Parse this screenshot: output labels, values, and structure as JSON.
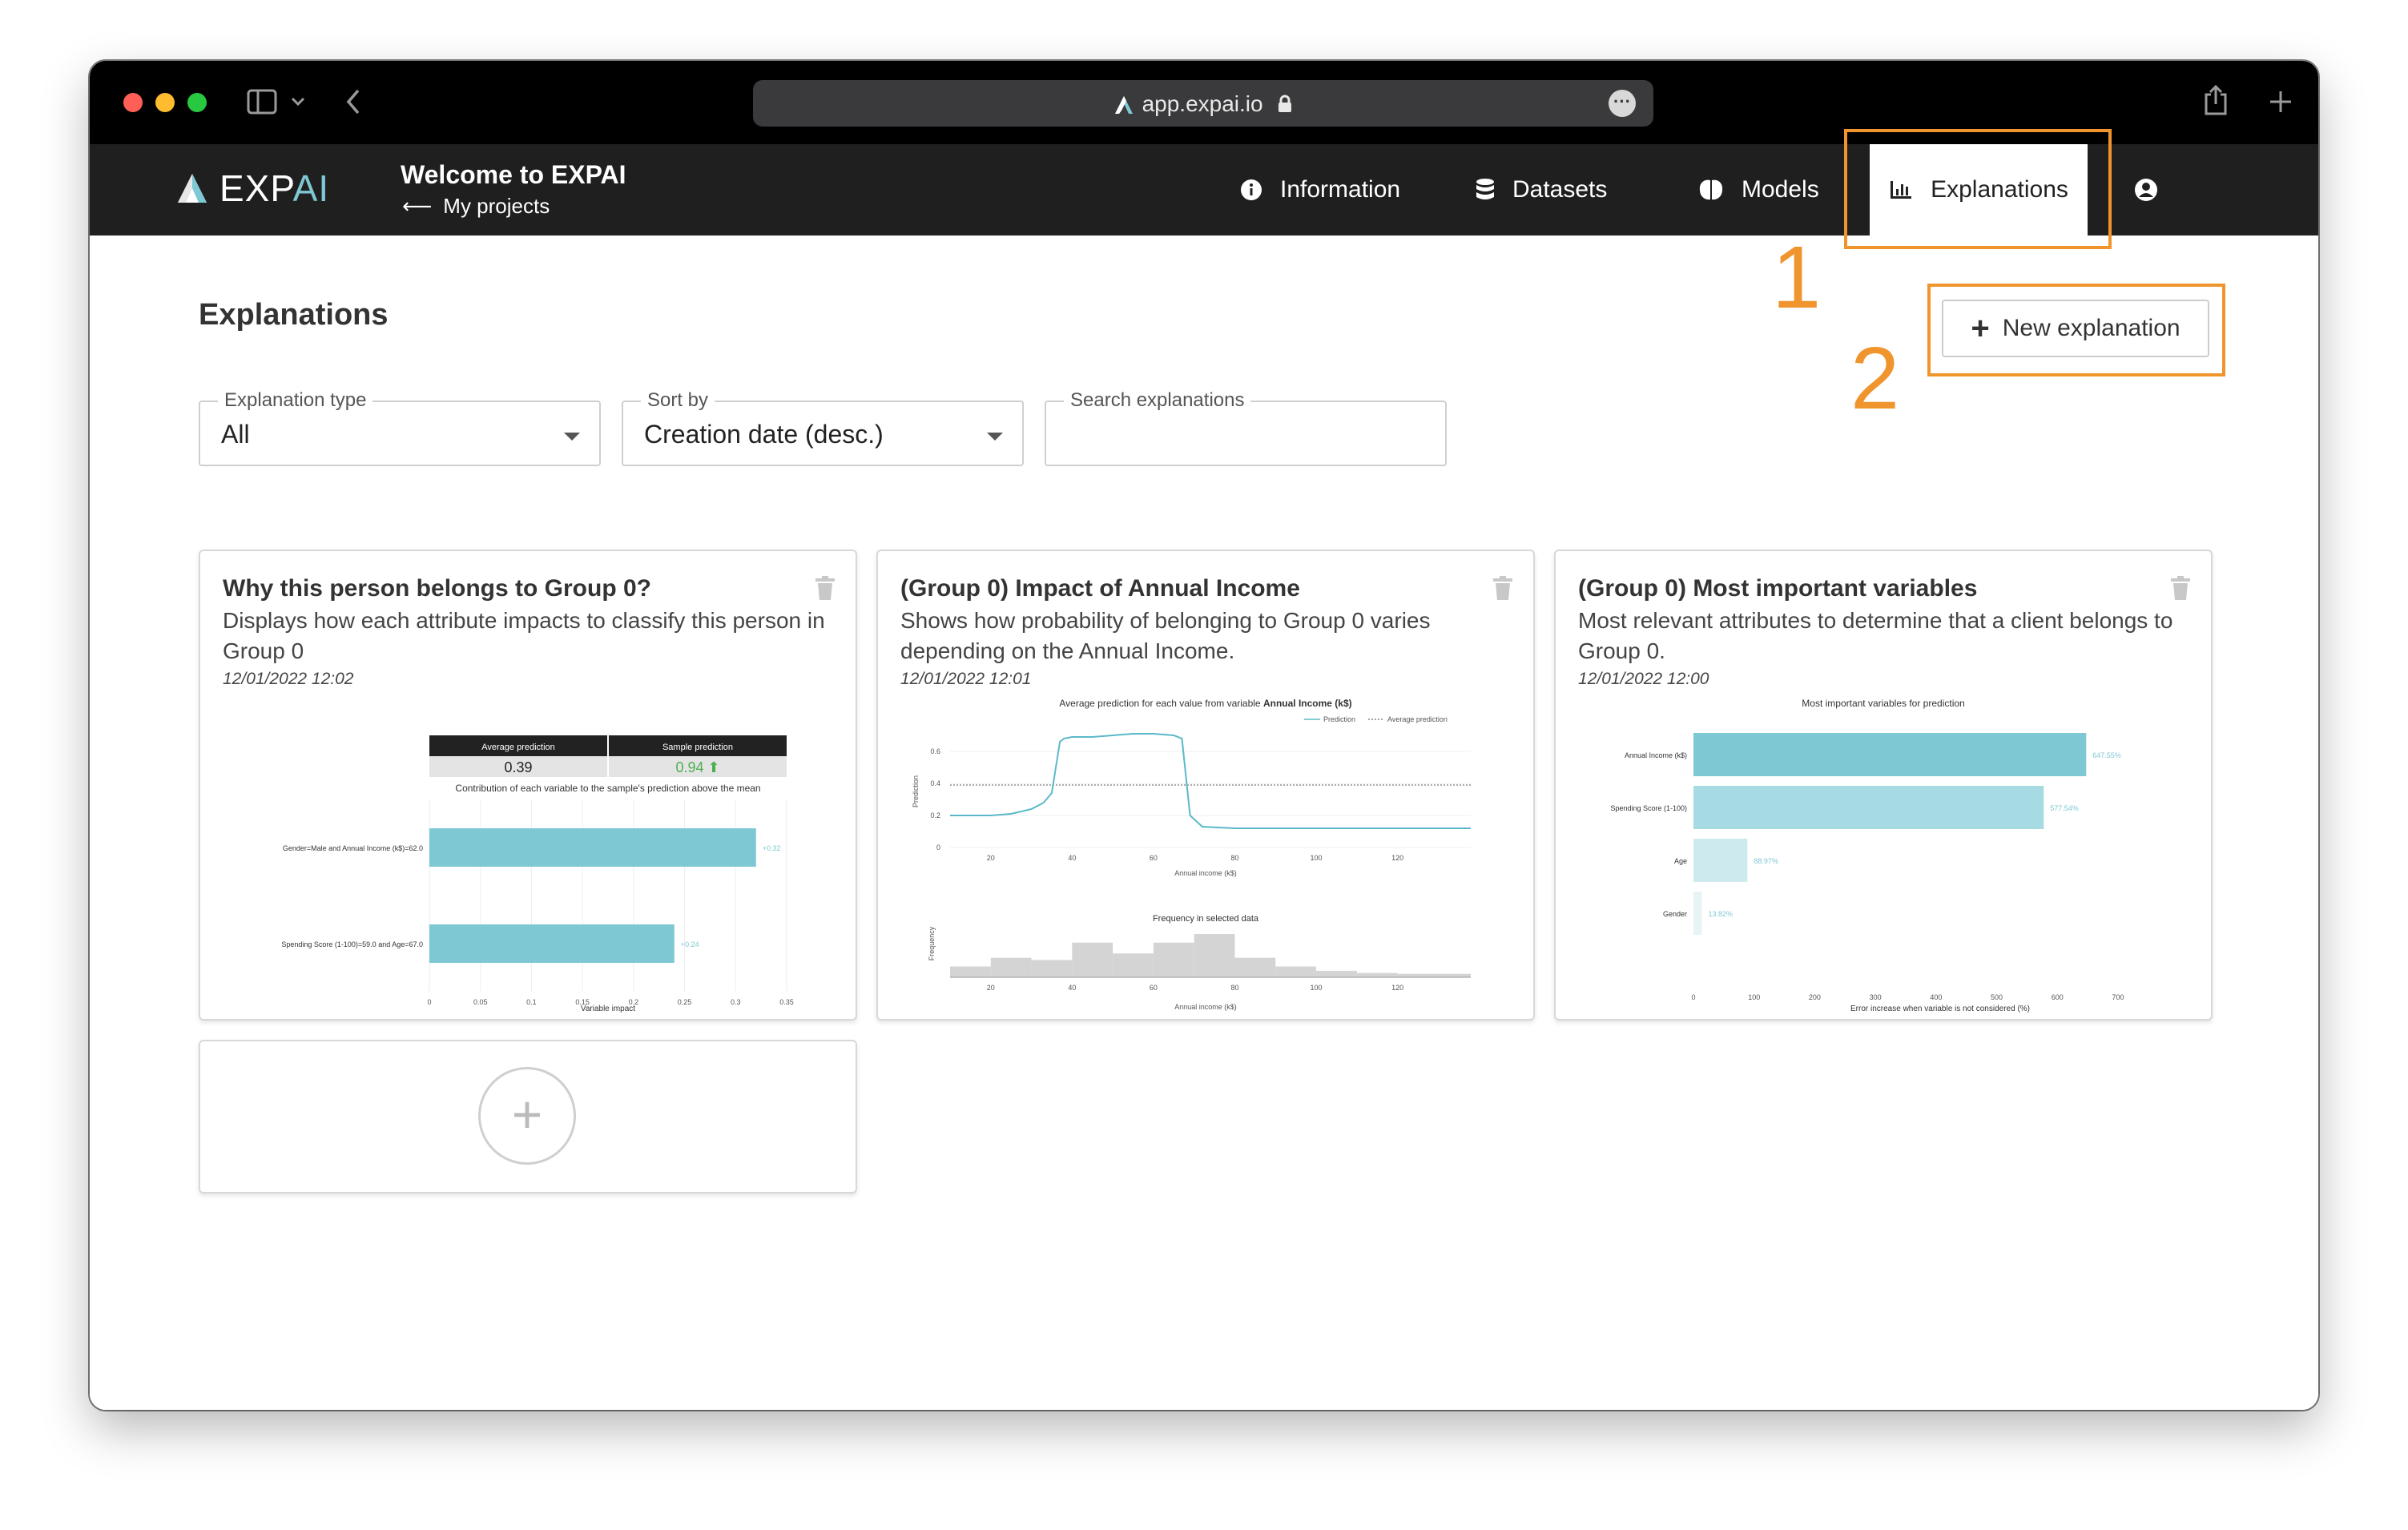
{
  "browser": {
    "url": "app.expai.io"
  },
  "header": {
    "logo_main": "EXP",
    "logo_accent": "AI",
    "project_title": "Welcome to EXPAI",
    "back_link": "My projects",
    "nav": [
      {
        "label": "Information",
        "icon": "info-icon"
      },
      {
        "label": "Datasets",
        "icon": "database-icon"
      },
      {
        "label": "Models",
        "icon": "brain-icon"
      },
      {
        "label": "Explanations",
        "icon": "bar-chart-icon"
      }
    ]
  },
  "main": {
    "title": "Explanations",
    "new_button": "New explanation",
    "filters": {
      "type_label": "Explanation type",
      "type_value": "All",
      "sort_label": "Sort by",
      "sort_value": "Creation date (desc.)",
      "search_label": "Search explanations"
    },
    "cards": [
      {
        "title": "Why this person belongs to Group 0?",
        "description": "Displays how each attribute impacts to classify this person in Group 0",
        "date": "12/01/2022 12:02"
      },
      {
        "title": "(Group 0) Impact of Annual Income",
        "description": "Shows how probability of belonging to Group 0 varies depending on the Annual Income.",
        "date": "12/01/2022 12:01"
      },
      {
        "title": "(Group 0) Most important variables",
        "description": "Most relevant attributes to determine that a client belongs to Group 0.",
        "date": "12/01/2022 12:00"
      }
    ]
  },
  "annotations": {
    "first": "1",
    "second": "2"
  },
  "colors": {
    "accent": "#7ec8d4",
    "highlight": "#f0952e",
    "navbar": "#1f1f1f"
  },
  "chart_data": [
    {
      "type": "bar",
      "orientation": "horizontal",
      "title": "Contribution of each variable to the sample's prediction above the mean",
      "xlabel": "Variable impact",
      "xlim": [
        0,
        0.35
      ],
      "x_ticks": [
        "0",
        "0.05",
        "0.1",
        "0.15",
        "0.2",
        "0.25",
        "0.3",
        "0.35"
      ],
      "summary": {
        "avg_label": "Average prediction",
        "avg_value": "0.39",
        "sample_label": "Sample prediction",
        "sample_value": "0.94 ⬆"
      },
      "categories": [
        "Gender=Male and Annual Income (k$)=62.0",
        "Spending Score (1-100)=59.0 and Age=67.0"
      ],
      "values": [
        0.32,
        0.24
      ],
      "value_labels": [
        "+0.32",
        "+0.24"
      ]
    },
    {
      "type": "line",
      "title_prefix": "Average prediction for each value from variable ",
      "title_bold": "Annual Income (k$)",
      "xlabel": "Annual income (k$)",
      "ylabel": "Prediction",
      "xlim": [
        10,
        138
      ],
      "ylim": [
        0,
        0.75
      ],
      "y_ticks": [
        "0",
        "0.2",
        "0.4",
        "0.6"
      ],
      "x_ticks": [
        "20",
        "40",
        "60",
        "80",
        "100",
        "120"
      ],
      "legend": [
        "Prediction",
        "Average prediction"
      ],
      "average": 0.39,
      "x": [
        10,
        20,
        25,
        30,
        33,
        35,
        37,
        38,
        40,
        45,
        50,
        55,
        60,
        65,
        67,
        69,
        72,
        80,
        100,
        120,
        138
      ],
      "y": [
        0.2,
        0.2,
        0.21,
        0.24,
        0.28,
        0.34,
        0.66,
        0.68,
        0.69,
        0.69,
        0.7,
        0.71,
        0.71,
        0.7,
        0.68,
        0.2,
        0.13,
        0.12,
        0.12,
        0.12,
        0.12
      ],
      "histogram": {
        "title": "Frequency in selected data",
        "ylabel": "Frequency",
        "xlabel": "Annual income (k$)",
        "x_ticks": [
          "20",
          "40",
          "60",
          "80",
          "100",
          "120"
        ],
        "bins": [
          [
            10,
            20,
            0.25
          ],
          [
            20,
            30,
            0.45
          ],
          [
            30,
            40,
            0.4
          ],
          [
            40,
            50,
            0.8
          ],
          [
            50,
            60,
            0.55
          ],
          [
            60,
            70,
            0.8
          ],
          [
            70,
            80,
            1.0
          ],
          [
            80,
            90,
            0.45
          ],
          [
            90,
            100,
            0.25
          ],
          [
            100,
            110,
            0.15
          ],
          [
            110,
            120,
            0.1
          ],
          [
            120,
            138,
            0.08
          ]
        ]
      }
    },
    {
      "type": "bar",
      "orientation": "horizontal",
      "title": "Most important variables for prediction",
      "xlabel": "Error increase when variable is not considered (%)",
      "xlim": [
        0,
        700
      ],
      "x_ticks": [
        "0",
        "100",
        "200",
        "300",
        "400",
        "500",
        "600",
        "700"
      ],
      "categories": [
        "Annual Income (k$)",
        "Spending Score (1-100)",
        "Age",
        "Gender"
      ],
      "values": [
        647.55,
        577.54,
        88.97,
        13.82
      ],
      "value_labels": [
        "647.55%",
        "577.54%",
        "88.97%",
        "13.82%"
      ],
      "colors": [
        "#7ec8d4",
        "#a6dbe3",
        "#cdeaef",
        "#e6f4f6"
      ]
    }
  ]
}
